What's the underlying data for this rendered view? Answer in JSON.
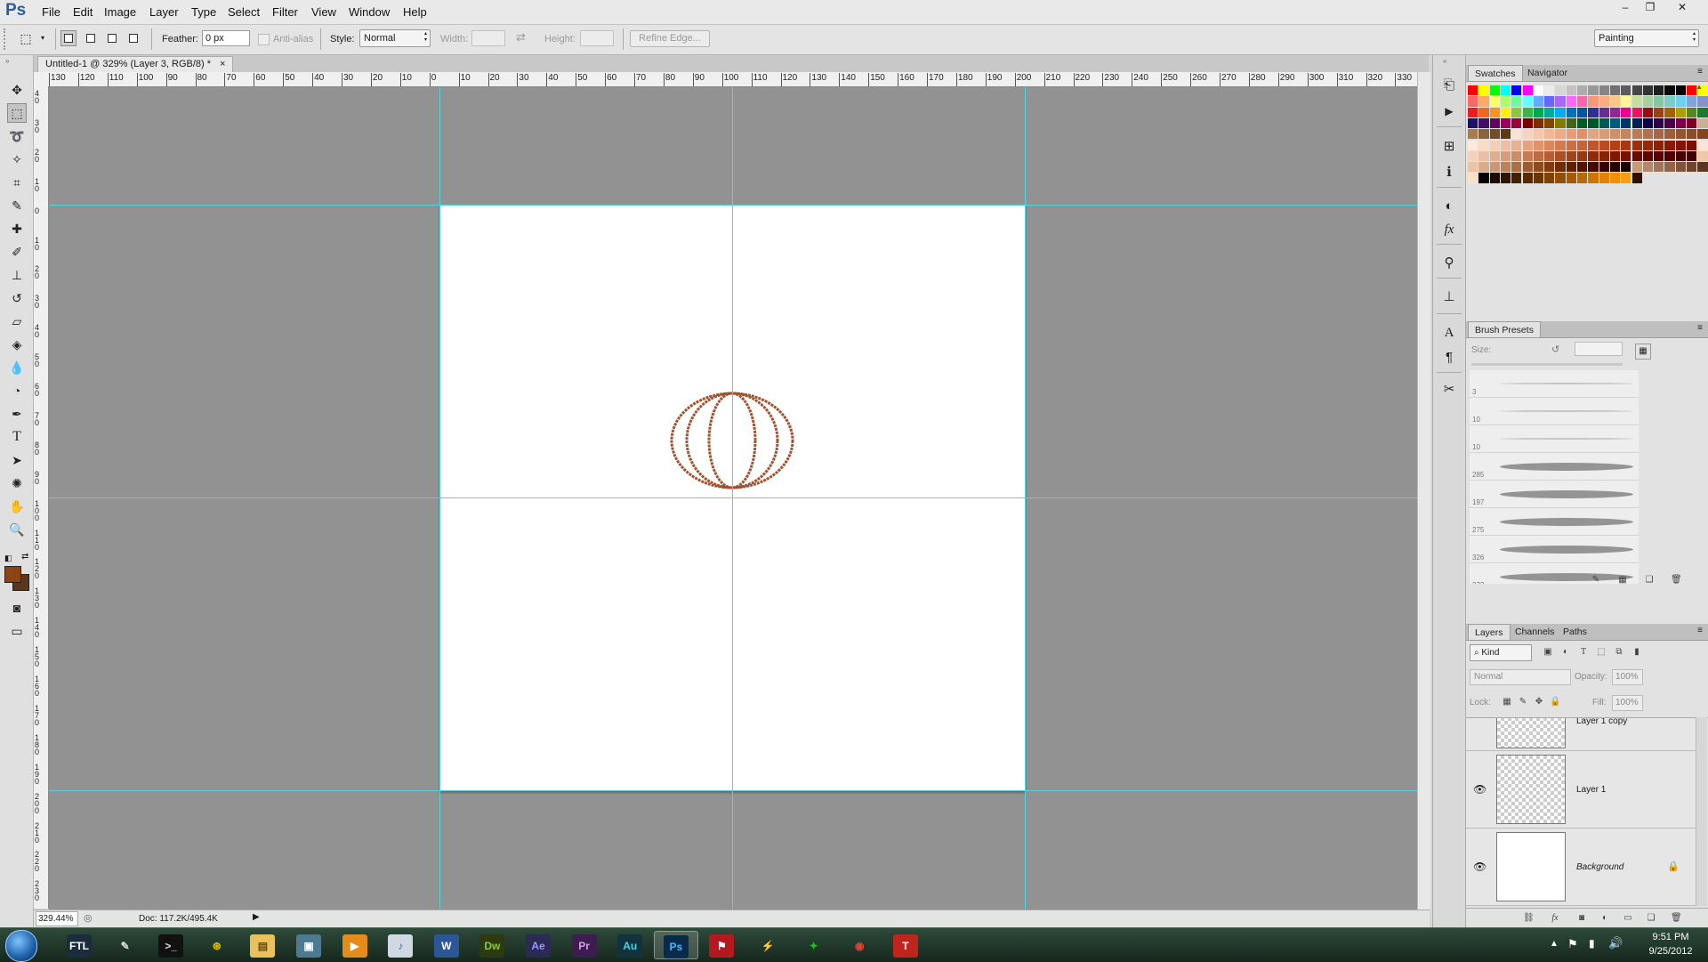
{
  "app": {
    "logo": "Ps"
  },
  "menu": [
    "File",
    "Edit",
    "Image",
    "Layer",
    "Type",
    "Select",
    "Filter",
    "View",
    "Window",
    "Help"
  ],
  "window_controls": {
    "minimize": "–",
    "restore": "❐",
    "close": "✕"
  },
  "options": {
    "feather_label": "Feather:",
    "feather_value": "0 px",
    "antialias_label": "Anti-alias",
    "style_label": "Style:",
    "style_value": "Normal",
    "width_label": "Width:",
    "height_label": "Height:",
    "refine_edge": "Refine Edge...",
    "workspace": "Painting"
  },
  "document": {
    "tab_title": "Untitled-1 @ 329% (Layer 3, RGB/8) *",
    "close": "×",
    "zoom": "329.44%",
    "doc_info": "Doc: 117.2K/495.4K"
  },
  "ruler": {
    "top": [
      "130",
      "120",
      "110",
      "100",
      "90",
      "80",
      "70",
      "60",
      "50",
      "40",
      "30",
      "20",
      "10",
      "0",
      "10",
      "20",
      "30",
      "40",
      "50",
      "60",
      "70",
      "80",
      "90",
      "100",
      "110",
      "120",
      "130",
      "140",
      "150",
      "160",
      "170",
      "180",
      "190",
      "200",
      "210",
      "220",
      "230",
      "240",
      "250",
      "260",
      "270",
      "280",
      "290",
      "300",
      "310",
      "320",
      "330"
    ],
    "left": [
      "40",
      "30",
      "20",
      "10",
      "0",
      "10",
      "20",
      "30",
      "40",
      "50",
      "60",
      "70",
      "80",
      "90",
      "100",
      "110",
      "120",
      "130",
      "140",
      "150",
      "160",
      "170",
      "180",
      "190",
      "200",
      "210",
      "220",
      "230",
      "240"
    ]
  },
  "colors": {
    "foreground": "#8b4513",
    "background": "#5a3820",
    "guide": "#4fd5e0",
    "drawing_stroke": "#a0522d"
  },
  "panels": {
    "swatches_tab": "Swatches",
    "navigator_tab": "Navigator",
    "brush_presets_tab": "Brush Presets",
    "size_label": "Size:",
    "brushes": [
      {
        "size": "3"
      },
      {
        "size": "10"
      },
      {
        "size": "10"
      },
      {
        "size": "285"
      },
      {
        "size": "197"
      },
      {
        "size": "275"
      },
      {
        "size": "326"
      },
      {
        "size": "373"
      }
    ],
    "layers_tab": "Layers",
    "channels_tab": "Channels",
    "paths_tab": "Paths",
    "kind_filter": "Kind",
    "blend_mode": "Normal",
    "opacity_label": "Opacity:",
    "opacity_value": "100%",
    "lock_label": "Lock:",
    "fill_label": "Fill:",
    "fill_value": "100%",
    "layers": [
      {
        "name": "Layer 1 copy",
        "visible": false
      },
      {
        "name": "Layer 1",
        "visible": true
      },
      {
        "name": "Background",
        "visible": true,
        "locked": true
      }
    ]
  },
  "taskbar": {
    "apps": [
      "start",
      "explorer-game",
      "pen",
      "cmd",
      "network",
      "folder",
      "tv",
      "media",
      "itunes",
      "Word",
      "Dw",
      "Ae",
      "Pr",
      "Au",
      "Ps",
      "game",
      "flash",
      "razer",
      "chrome",
      "T"
    ],
    "time": "9:51 PM",
    "date": "9/25/2012"
  }
}
